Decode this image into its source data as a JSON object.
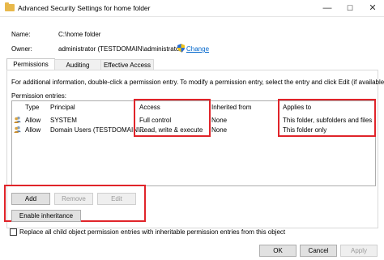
{
  "window": {
    "title": "Advanced Security Settings for home folder",
    "controls": {
      "minimize": "—",
      "maximize": "☐",
      "close": "✕"
    }
  },
  "info": {
    "name_label": "Name:",
    "name_value": "C:\\home folder",
    "owner_label": "Owner:",
    "owner_value": "administrator (TESTDOMAIN\\administrator)",
    "change_link": "Change"
  },
  "tabs": [
    {
      "label": "Permissions",
      "active": true
    },
    {
      "label": "Auditing",
      "active": false
    },
    {
      "label": "Effective Access",
      "active": false
    }
  ],
  "permissions": {
    "help_text": "For additional information, double-click a permission entry. To modify a permission entry, select the entry and click Edit (if available).",
    "entries_label": "Permission entries:",
    "columns": [
      "Type",
      "Principal",
      "Access",
      "Inherited from",
      "Applies to"
    ],
    "rows": [
      {
        "type": "Allow",
        "principal": "SYSTEM",
        "access": "Full control",
        "inherited_from": "None",
        "applies_to": "This folder, subfolders and files"
      },
      {
        "type": "Allow",
        "principal": "Domain Users (TESTDOMAIN\\...",
        "access": "Read, write & execute",
        "inherited_from": "None",
        "applies_to": "This folder only"
      }
    ]
  },
  "buttons": {
    "add": "Add",
    "remove": "Remove",
    "edit": "Edit",
    "enable_inheritance": "Enable inheritance"
  },
  "replace_checkbox": {
    "label": "Replace all child object permission entries with inheritable permission entries from this object",
    "checked": false
  },
  "footer": {
    "ok": "OK",
    "cancel": "Cancel",
    "apply": "Apply"
  },
  "colors": {
    "highlight_box": "#e0242a",
    "link": "#0066cc"
  }
}
